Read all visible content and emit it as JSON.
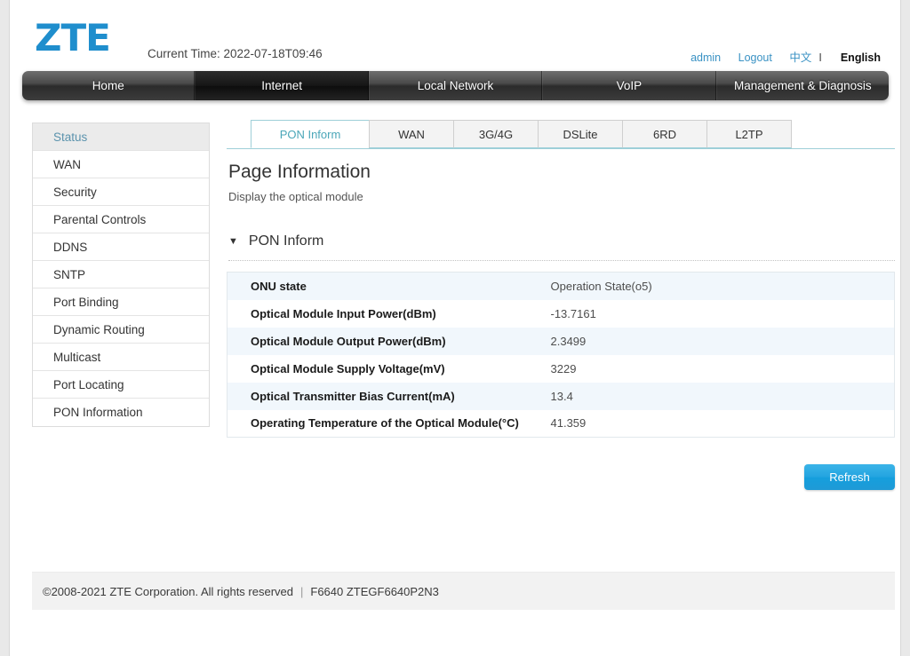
{
  "header": {
    "logo_text": "ZTE",
    "current_time": "Current Time: 2022-07-18T09:46",
    "user_label": "admin",
    "logout_label": "Logout",
    "lang_cn": "中文",
    "lang_sep": "I",
    "lang_en": "English"
  },
  "nav": {
    "items": [
      {
        "label": "Home",
        "active": false
      },
      {
        "label": "Internet",
        "active": true
      },
      {
        "label": "Local Network",
        "active": false
      },
      {
        "label": "VoIP",
        "active": false
      },
      {
        "label": "Management & Diagnosis",
        "active": false
      }
    ]
  },
  "sidebar": {
    "items": [
      {
        "label": "Status",
        "active": true
      },
      {
        "label": "WAN",
        "active": false
      },
      {
        "label": "Security",
        "active": false
      },
      {
        "label": "Parental Controls",
        "active": false
      },
      {
        "label": "DDNS",
        "active": false
      },
      {
        "label": "SNTP",
        "active": false
      },
      {
        "label": "Port Binding",
        "active": false
      },
      {
        "label": "Dynamic Routing",
        "active": false
      },
      {
        "label": "Multicast",
        "active": false
      },
      {
        "label": "Port Locating",
        "active": false
      },
      {
        "label": "PON Information",
        "active": false
      }
    ]
  },
  "tabs": {
    "items": [
      {
        "label": "PON Inform",
        "active": true
      },
      {
        "label": "WAN",
        "active": false
      },
      {
        "label": "3G/4G",
        "active": false
      },
      {
        "label": "DSLite",
        "active": false
      },
      {
        "label": "6RD",
        "active": false
      },
      {
        "label": "L2TP",
        "active": false
      }
    ]
  },
  "main": {
    "title": "Page Information",
    "subtitle": "Display the optical module",
    "section_caret": "▼",
    "section_title": "PON Inform",
    "rows": [
      {
        "key": "ONU state",
        "value": "Operation State(o5)"
      },
      {
        "key": "Optical Module Input Power(dBm)",
        "value": "-13.7161"
      },
      {
        "key": "Optical Module Output Power(dBm)",
        "value": "2.3499"
      },
      {
        "key": "Optical Module Supply Voltage(mV)",
        "value": "3229"
      },
      {
        "key": "Optical Transmitter Bias Current(mA)",
        "value": "13.4"
      },
      {
        "key": "Operating Temperature of the Optical Module(°C)",
        "value": "41.359"
      }
    ],
    "refresh_label": "Refresh"
  },
  "footer": {
    "copyright": "©2008-2021 ZTE Corporation. All rights reserved",
    "separator": "|",
    "model": "F6640 ZTEGF6640P2N3"
  },
  "colors": {
    "brand_blue": "#1f8ecd",
    "link_blue": "#3a92c4",
    "tab_active": "#4aa6b8",
    "button_blue": "#23a4e0",
    "row_stripe": "#f1f7fc"
  }
}
